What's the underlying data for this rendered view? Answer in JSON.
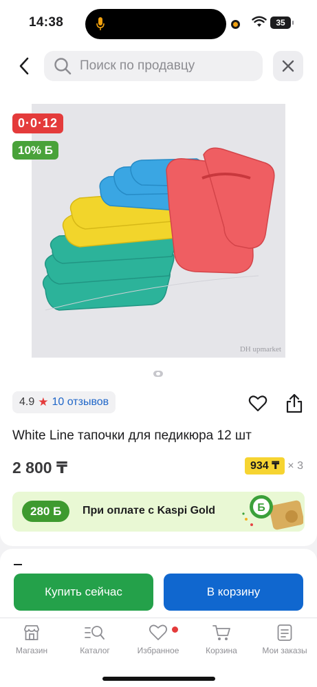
{
  "status_bar": {
    "time": "14:38",
    "battery": "35"
  },
  "search": {
    "placeholder": "Поиск по продавцу"
  },
  "product": {
    "image_watermark": "DH upmarket",
    "badge_installment": "0·0·12",
    "badge_bonus": "10% Б",
    "rating": "4.9",
    "reviews": "10 отзывов",
    "title": "White Line тапочки для педикюра 12 шт",
    "price": "2 800 ₸",
    "installment_amount": "934 ₸",
    "installment_count": "× 3"
  },
  "kaspi_banner": {
    "bonus": "280 Б",
    "text": "При оплате с Kaspi Gold"
  },
  "actions": {
    "buy_now": "Купить сейчас",
    "to_cart": "В корзину"
  },
  "nav": {
    "items": [
      {
        "label": "Магазин",
        "icon": "store-icon"
      },
      {
        "label": "Каталог",
        "icon": "catalog-search-icon"
      },
      {
        "label": "Избранное",
        "icon": "heart-icon"
      },
      {
        "label": "Корзина",
        "icon": "cart-icon"
      },
      {
        "label": "Мои заказы",
        "icon": "orders-icon"
      }
    ]
  },
  "colors": {
    "accent_red": "#e43b3b",
    "bonus_green": "#49a23a",
    "buy_green": "#24a14a",
    "cart_blue": "#1067cf",
    "installment_yellow": "#f6d431",
    "link_blue": "#1f66c8"
  }
}
